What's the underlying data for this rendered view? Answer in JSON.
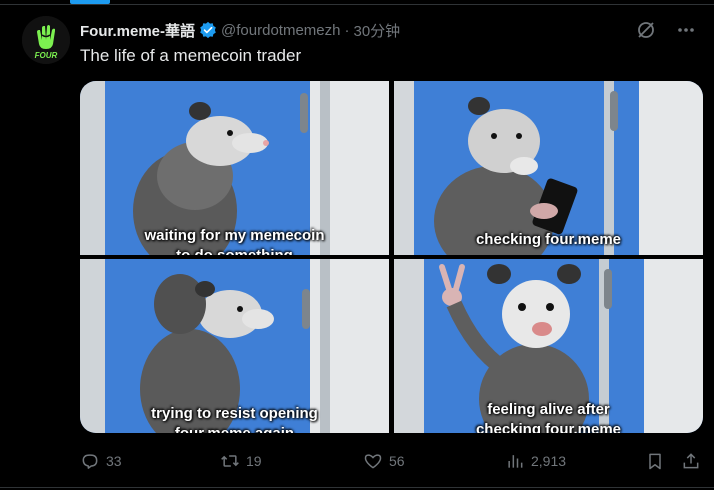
{
  "tweet": {
    "display_name": "Four.meme-華語",
    "handle": "@fourdotmemezh",
    "separator": "·",
    "time_ago": "30分钟",
    "text": "The life of a memecoin trader",
    "avatar": {
      "logo_text": "FOUR",
      "icon": "hand-logo-icon"
    },
    "verified_icon": "verified-badge-icon"
  },
  "media_panels": [
    {
      "caption_line1": "waiting for my memecoin",
      "caption_line2": "to do something"
    },
    {
      "caption_line1": "checking four.meme",
      "caption_line2": ""
    },
    {
      "caption_line1": "trying to resist opening",
      "caption_line2": "four.meme again"
    },
    {
      "caption_line1": "feeling alive after",
      "caption_line2": "checking four.meme"
    }
  ],
  "actions": {
    "replies": "33",
    "retweets": "19",
    "likes": "56",
    "views": "2,913"
  },
  "colors": {
    "accent": "#1d9bf0",
    "logo_green": "#7cf050",
    "muted": "#71767b"
  }
}
